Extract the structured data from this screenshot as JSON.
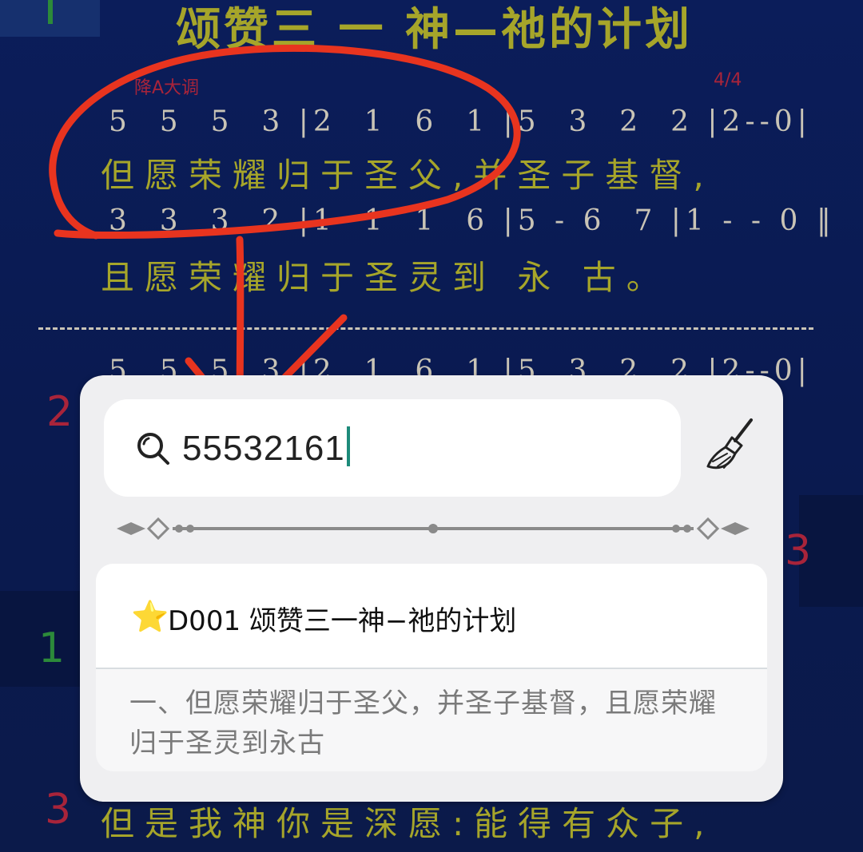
{
  "song": {
    "title": "颂赞三 一 神—祂的计划",
    "key": "降A大调",
    "meter": "4/4",
    "line1_notes": "5  5  5  3 |2  1  6  1 |5  3  2  2 |2--0|",
    "line1_lyrics": "但愿荣耀归于圣父,并圣子基督,",
    "line2_notes": "3  3  3  2 |1  1  1  6 |5 - 6  7 |1 - - 0 ‖",
    "line2_lyrics": "且愿荣耀归于圣灵到 永  古。",
    "line3_notes": "5  5  5  3 |2  1  6  1 |5  3  2  2 |2--0|",
    "line4_lyrics": "但是我神你是深愿:能得有众子,",
    "verse_numbers": [
      "2",
      "3",
      "1",
      "3"
    ]
  },
  "search": {
    "query": "55532161",
    "search_icon": "magnifier",
    "clear_icon": "broom"
  },
  "result": {
    "star_icon": "⭐",
    "title": "D001 颂赞三一神−祂的计划",
    "snippet": "一、但愿荣耀归于圣父，并圣子基督，且愿荣耀归于圣灵到永古"
  },
  "colors": {
    "background": "#0b1d5a",
    "lyrics": "#a6a52a",
    "annotation": "#e8341f",
    "caret": "#1d8a7a"
  }
}
